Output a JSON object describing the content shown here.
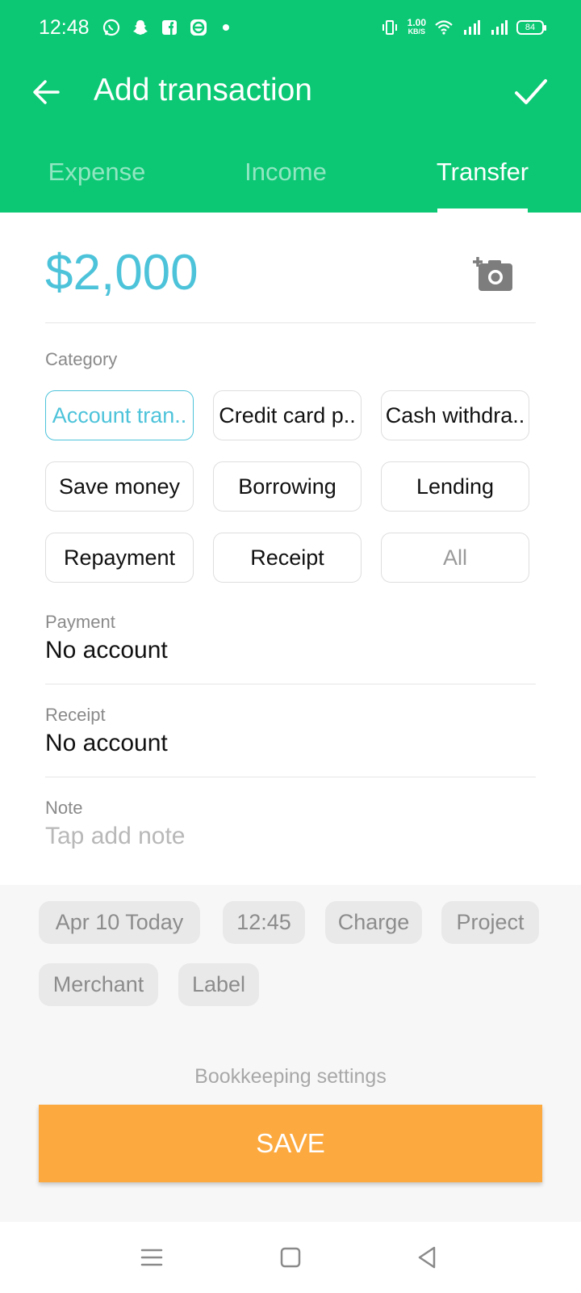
{
  "status_bar": {
    "time": "12:48",
    "speed_value": "1.00",
    "speed_unit": "KB/S",
    "battery": "84",
    "left_icons": [
      "whatsapp-icon",
      "snapchat-icon",
      "facebook-icon",
      "app-icon",
      "dot-icon"
    ],
    "right_icons": [
      "vibrate-icon",
      "wifi-icon",
      "signal-icon",
      "signal-icon",
      "battery-icon"
    ]
  },
  "header": {
    "title": "Add transaction",
    "back_icon": "arrow-back-icon",
    "confirm_icon": "check-icon",
    "background": "#0cc875"
  },
  "tabs": [
    {
      "label": "Expense",
      "active": false
    },
    {
      "label": "Income",
      "active": false
    },
    {
      "label": "Transfer",
      "active": true
    }
  ],
  "amount": {
    "value": "$2,000",
    "color": "#4dc3da",
    "camera_icon": "add-photo-icon"
  },
  "category": {
    "label": "Category",
    "chips": [
      {
        "label": "Account tran..",
        "selected": true
      },
      {
        "label": "Credit card p..",
        "selected": false
      },
      {
        "label": "Cash withdra..",
        "selected": false
      },
      {
        "label": "Save money",
        "selected": false
      },
      {
        "label": "Borrowing",
        "selected": false
      },
      {
        "label": "Lending",
        "selected": false
      },
      {
        "label": "Repayment",
        "selected": false
      },
      {
        "label": "Receipt",
        "selected": false
      },
      {
        "label": "All",
        "selected": false
      }
    ]
  },
  "payment": {
    "label": "Payment",
    "value": "No account"
  },
  "receipt": {
    "label": "Receipt",
    "value": "No account"
  },
  "note": {
    "label": "Note",
    "placeholder": "Tap add note"
  },
  "extras": {
    "date": "Apr 10  Today",
    "time": "12:45",
    "charge": "Charge",
    "project": "Project",
    "merchant": "Merchant",
    "label": "Label"
  },
  "bookkeeping_settings": "Bookkeeping settings",
  "save_button": {
    "label": "SAVE",
    "color": "#fcaa40"
  },
  "nav_bar": {
    "icons": [
      "menu-icon",
      "home-square-icon",
      "back-triangle-icon"
    ]
  }
}
